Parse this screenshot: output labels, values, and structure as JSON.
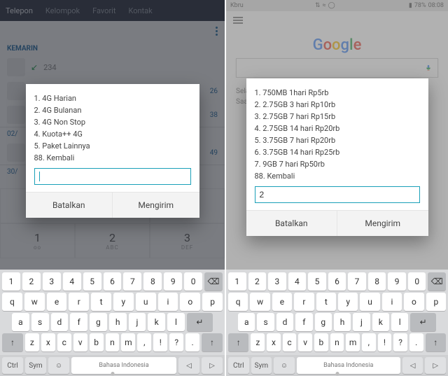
{
  "left": {
    "tabs": [
      "Telepon",
      "Kelompok",
      "Favorit",
      "Kontak"
    ],
    "section": "KEMARIN",
    "row_arrow": "↙",
    "row_number": "234",
    "times": [
      "26",
      "38",
      "49"
    ],
    "date2_prefix": "02/",
    "date3": "30/",
    "dialog": {
      "items": [
        "1. 4G Harian",
        "2. 4G Bulanan",
        "3. 4G Non Stop",
        "4. Kuota++ 4G",
        "5. Paket Lainnya",
        "88. Kembali"
      ],
      "value": "",
      "cancel": "Batalkan",
      "send": "Mengirim"
    },
    "keys_num": [
      "1",
      "2",
      "3",
      "4",
      "5",
      "6",
      "7",
      "8",
      "9",
      "0"
    ],
    "keys_r2": [
      "q",
      "w",
      "e",
      "r",
      "t",
      "y",
      "u",
      "i",
      "o",
      "p"
    ],
    "keys_r3": [
      "a",
      "s",
      "d",
      "f",
      "g",
      "h",
      "j",
      "k",
      "l"
    ],
    "keys_r4": [
      "z",
      "x",
      "c",
      "v",
      "b",
      "n",
      "m"
    ],
    "shift": "↑",
    "bksp": "⌫",
    "enter": "↵",
    "punct": [
      ",",
      "!",
      "?",
      "."
    ],
    "bottom": {
      "ctrl": "Ctrl",
      "sym": "Sym",
      "emoji": "☺",
      "lang": "Bahasa Indonesia",
      "left": "◁",
      "right": "▷"
    },
    "dial": {
      "1": "1",
      "1s": "ᴏᴏ",
      "2": "2",
      "2s": "ABC",
      "3": "3",
      "3s": "DEF",
      "plus": "+"
    }
  },
  "right": {
    "status": {
      "left": "Kbru",
      "net": "⇅",
      "wifi": "≈",
      "ball": "◯",
      "sig": "▮",
      "batt": "78%",
      "time": "08:08"
    },
    "google": {
      "G": "G",
      "o1": "o",
      "o2": "o",
      "g": "g",
      "l": "l",
      "e": "e"
    },
    "snippet1": "Selap",
    "snippet2": "Saat",
    "dialog": {
      "items": [
        "1. 750MB 1hari Rp5rb",
        "2. 2.75GB 3 hari Rp10rb",
        "3. 2.75GB 7 hari Rp15rb",
        "4. 2.75GB 14 hari Rp20rb",
        "5. 3.75GB 7 hari Rp20rb",
        "6. 3.75GB 14 hari Rp25rb",
        "7. 9GB 7 hari Rp50rb",
        "88. Kembali"
      ],
      "value": "2",
      "cancel": "Batalkan",
      "send": "Mengirim"
    }
  }
}
